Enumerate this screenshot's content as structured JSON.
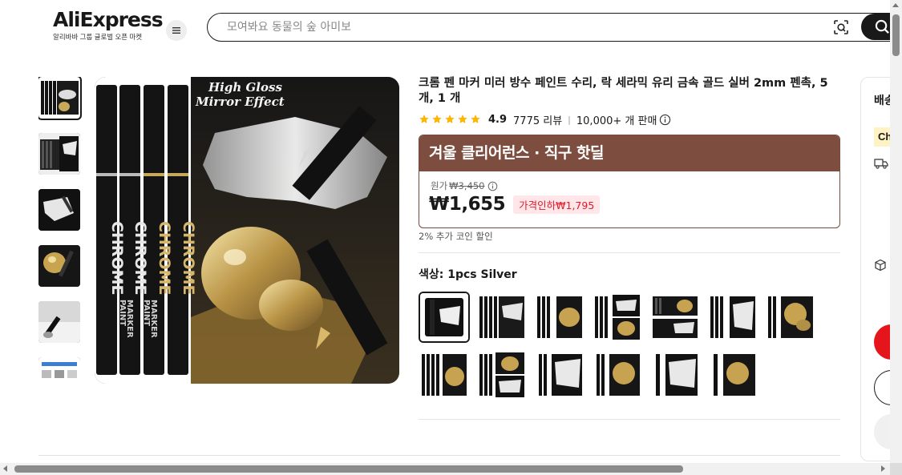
{
  "header": {
    "logo_text": "AliExpress",
    "logo_tagline": "알리바바 그룹 글로벌 오픈 마켓",
    "search_placeholder": "모여봐요 동물의 숲 아미보"
  },
  "gallery": {
    "thumbnail_count": 6,
    "main_image": {
      "overlay_text_line1": "High Gloss",
      "overlay_text_line2": "Mirror Effect",
      "marker_brand": "CHROME",
      "marker_type_line1": "PAINT",
      "marker_type_line2": "MARKER"
    }
  },
  "product": {
    "title": "크롬 펜 마커 미러 방수 페인트 수리, 락 세라믹 유리 금속 골드 실버 2mm 펜촉, 5 개, 1 개",
    "rating": "4.9",
    "reviews": "7775 리뷰",
    "separator": "|",
    "sold": "10,000+ 개 판매"
  },
  "deal": {
    "banner": "겨울 클리어런스 · 직구 핫딜",
    "original_label": "원가",
    "original_price": "₩3,450",
    "price": "₩1,655",
    "discount_badge": "가격인하₩1,795",
    "coin_note": "2% 추가 코인 할인"
  },
  "variants": {
    "label": "색상: 1pcs Silver",
    "selected_index": 0,
    "count": 14
  },
  "side_panel": {
    "title": "배송",
    "choice_badge": "Ch"
  },
  "colors": {
    "deal_banner": "#7d4e3f",
    "discount_text": "#e01b2c",
    "discount_bg": "#ffe6e8",
    "star": "#ffb400",
    "primary_button": "#e5161b"
  }
}
